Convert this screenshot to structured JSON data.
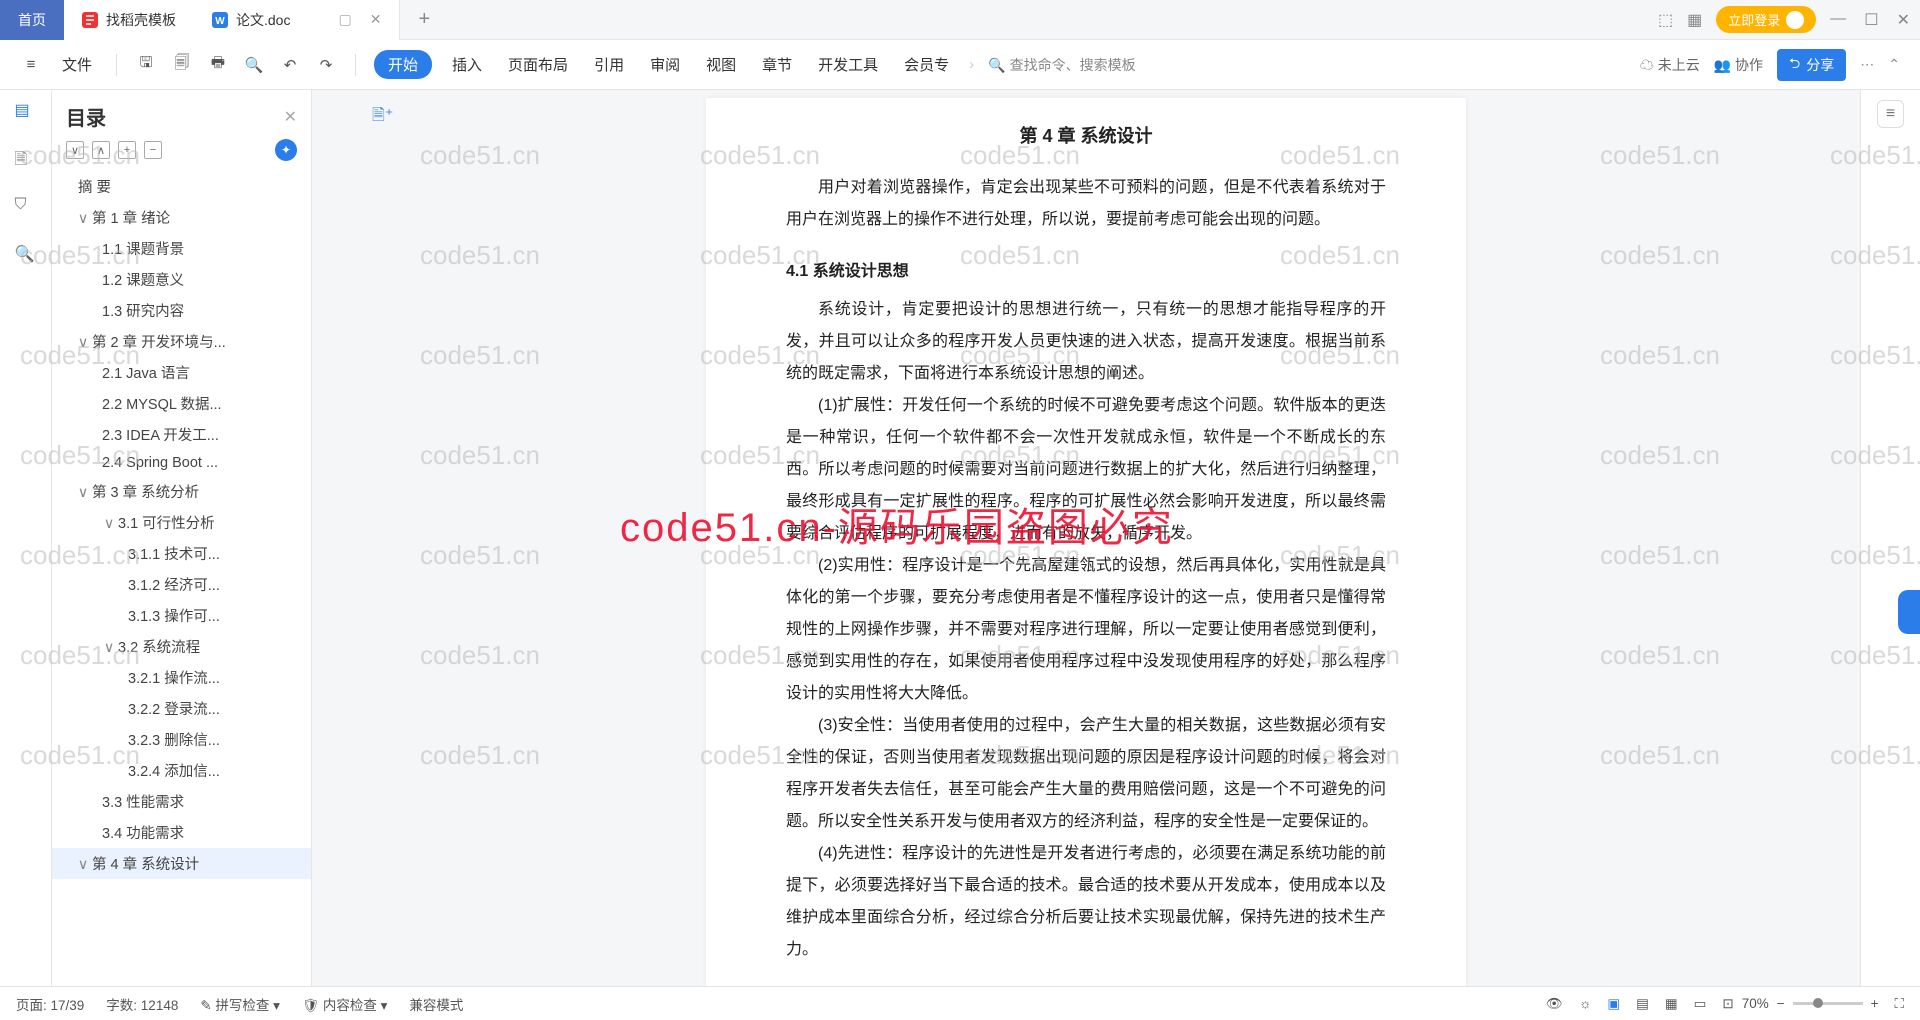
{
  "tabs": {
    "home": "首页",
    "template": "找稻壳模板",
    "doc": "论文.doc"
  },
  "login": "立即登录",
  "ribbon": {
    "file": "文件",
    "tabs": [
      "开始",
      "插入",
      "页面布局",
      "引用",
      "审阅",
      "视图",
      "章节",
      "开发工具",
      "会员专"
    ],
    "search": "查找命令、搜索模板",
    "cloud": "未上云",
    "collab": "协作",
    "share": "分享"
  },
  "outline": {
    "title": "目录",
    "items": [
      {
        "lvl": 0,
        "chev": "",
        "text": "摘  要",
        "sel": false
      },
      {
        "lvl": 1,
        "chev": "∨",
        "text": "第 1 章  绪论",
        "sel": false
      },
      {
        "lvl": 2,
        "chev": "",
        "text": "1.1 课题背景",
        "sel": false
      },
      {
        "lvl": 2,
        "chev": "",
        "text": "1.2 课题意义",
        "sel": false
      },
      {
        "lvl": 2,
        "chev": "",
        "text": "1.3 研究内容",
        "sel": false
      },
      {
        "lvl": 1,
        "chev": "∨",
        "text": "第 2 章  开发环境与...",
        "sel": false
      },
      {
        "lvl": 2,
        "chev": "",
        "text": "2.1 Java 语言",
        "sel": false
      },
      {
        "lvl": 2,
        "chev": "",
        "text": "2.2 MYSQL 数据...",
        "sel": false
      },
      {
        "lvl": 2,
        "chev": "",
        "text": "2.3 IDEA 开发工...",
        "sel": false
      },
      {
        "lvl": 2,
        "chev": "",
        "text": "2.4 Spring Boot ...",
        "sel": false
      },
      {
        "lvl": 1,
        "chev": "∨",
        "text": "第 3 章  系统分析",
        "sel": false
      },
      {
        "lvl": 2,
        "chev": "∨",
        "text": "3.1 可行性分析",
        "sel": false
      },
      {
        "lvl": 3,
        "chev": "",
        "text": "3.1.1 技术可...",
        "sel": false
      },
      {
        "lvl": 3,
        "chev": "",
        "text": "3.1.2 经济可...",
        "sel": false
      },
      {
        "lvl": 3,
        "chev": "",
        "text": "3.1.3 操作可...",
        "sel": false
      },
      {
        "lvl": 2,
        "chev": "∨",
        "text": "3.2 系统流程",
        "sel": false
      },
      {
        "lvl": 3,
        "chev": "",
        "text": "3.2.1 操作流...",
        "sel": false
      },
      {
        "lvl": 3,
        "chev": "",
        "text": "3.2.2 登录流...",
        "sel": false
      },
      {
        "lvl": 3,
        "chev": "",
        "text": "3.2.3 删除信...",
        "sel": false
      },
      {
        "lvl": 3,
        "chev": "",
        "text": "3.2.4 添加信...",
        "sel": false
      },
      {
        "lvl": 2,
        "chev": "",
        "text": "3.3 性能需求",
        "sel": false
      },
      {
        "lvl": 2,
        "chev": "",
        "text": "3.4 功能需求",
        "sel": false
      },
      {
        "lvl": 1,
        "chev": "∨",
        "text": "第 4 章  系统设计",
        "sel": true
      }
    ]
  },
  "doc": {
    "h2": "第 4 章  系统设计",
    "intro": "用户对着浏览器操作，肯定会出现某些不可预料的问题，但是不代表着系统对于用户在浏览器上的操作不进行处理，所以说，要提前考虑可能会出现的问题。",
    "h3": "4.1  系统设计思想",
    "p1": "系统设计，肯定要把设计的思想进行统一，只有统一的思想才能指导程序的开发，并且可以让众多的程序开发人员更快速的进入状态，提高开发速度。根据当前系统的既定需求，下面将进行本系统设计思想的阐述。",
    "p2": "(1)扩展性：开发任何一个系统的时候不可避免要考虑这个问题。软件版本的更迭是一种常识，任何一个软件都不会一次性开发就成永恒，软件是一个不断成长的东西。所以考虑问题的时候需要对当前问题进行数据上的扩大化，然后进行归纳整理，最终形成具有一定扩展性的程序。程序的可扩展性必然会影响开发进度，所以最终需要综合评估程序的可扩展程度，进而有的放矢，循序开发。",
    "p3": "(2)实用性：程序设计是一个先高屋建瓴式的设想，然后再具体化，实用性就是具体化的第一个步骤，要充分考虑使用者是不懂程序设计的这一点，使用者只是懂得常规性的上网操作步骤，并不需要对程序进行理解，所以一定要让使用者感觉到便利，感觉到实用性的存在，如果使用者使用程序过程中没发现使用程序的好处，那么程序设计的实用性将大大降低。",
    "p4": "(3)安全性：当使用者使用的过程中，会产生大量的相关数据，这些数据必须有安全性的保证，否则当使用者发现数据出现问题的原因是程序设计问题的时候，将会对程序开发者失去信任，甚至可能会产生大量的费用赔偿问题，这是一个不可避免的问题。所以安全性关系开发与使用者双方的经济利益，程序的安全性是一定要保证的。",
    "p5": "(4)先进性：程序设计的先进性是开发者进行考虑的，必须要在满足系统功能的前提下，必须要选择好当下最合适的技术。最合适的技术要从开发成本，使用成本以及维护成本里面综合分析，经过综合分析后要让技术实现最优解，保持先进的技术生产力。"
  },
  "status": {
    "page": "页面: 17/39",
    "words": "字数: 12148",
    "spell": "拼写检查",
    "content": "内容检查",
    "compat": "兼容模式",
    "zoom": "70%"
  },
  "watermark": "code51.cn",
  "watermark_red": "code51.cn-源码乐园盗图必究"
}
